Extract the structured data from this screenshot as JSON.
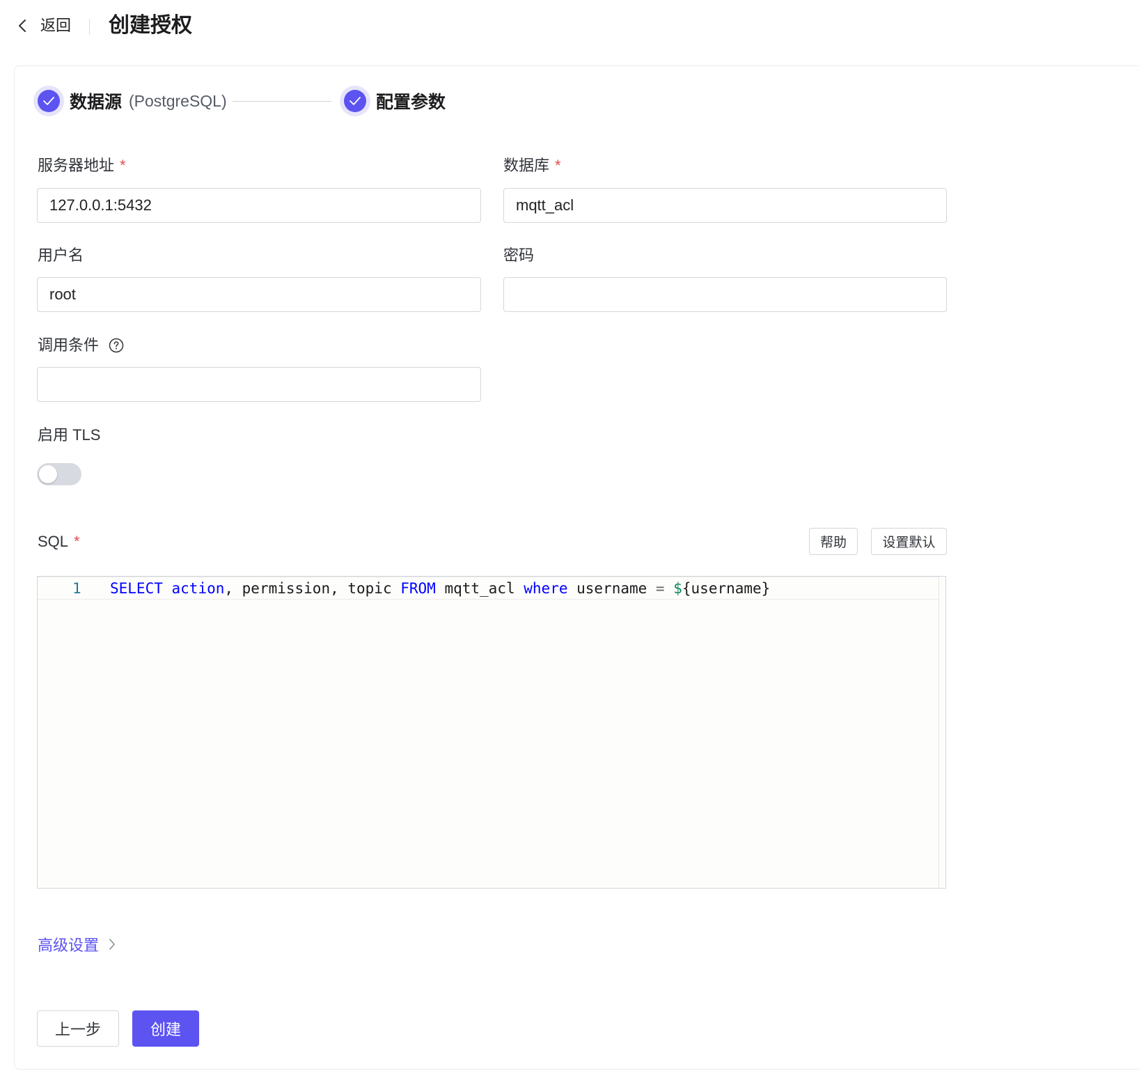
{
  "header": {
    "back_label": "返回",
    "title": "创建授权"
  },
  "steps": [
    {
      "title": "数据源",
      "subtitle": "(PostgreSQL)",
      "status": "done"
    },
    {
      "title": "配置参数",
      "subtitle": "",
      "status": "done"
    }
  ],
  "form": {
    "server": {
      "label": "服务器地址",
      "required": "*",
      "value": "127.0.0.1:5432"
    },
    "database": {
      "label": "数据库",
      "required": "*",
      "value": "mqtt_acl"
    },
    "username": {
      "label": "用户名",
      "value": "root"
    },
    "password": {
      "label": "密码",
      "value": ""
    },
    "condition": {
      "label": "调用条件",
      "value": ""
    },
    "tls": {
      "label": "启用 TLS",
      "enabled": false
    },
    "sql": {
      "label": "SQL",
      "required": "*",
      "help_button": "帮助",
      "default_button": "设置默认",
      "line_number": "1",
      "tokens": {
        "t1": "SELECT",
        "t2": "action",
        "t3": ", permission, topic ",
        "t4": "FROM",
        "t5": " mqtt_acl ",
        "t6": "where",
        "t7": " username ",
        "t8": "=",
        "t9": " ",
        "t10": "$",
        "t11": "{username}"
      }
    }
  },
  "advanced_label": "高级设置",
  "footer": {
    "prev_label": "上一步",
    "create_label": "创建"
  },
  "colors": {
    "primary": "#5c53f1",
    "required": "#e34d4d",
    "sql_keyword": "#0000ff",
    "sql_variable": "#098658"
  }
}
